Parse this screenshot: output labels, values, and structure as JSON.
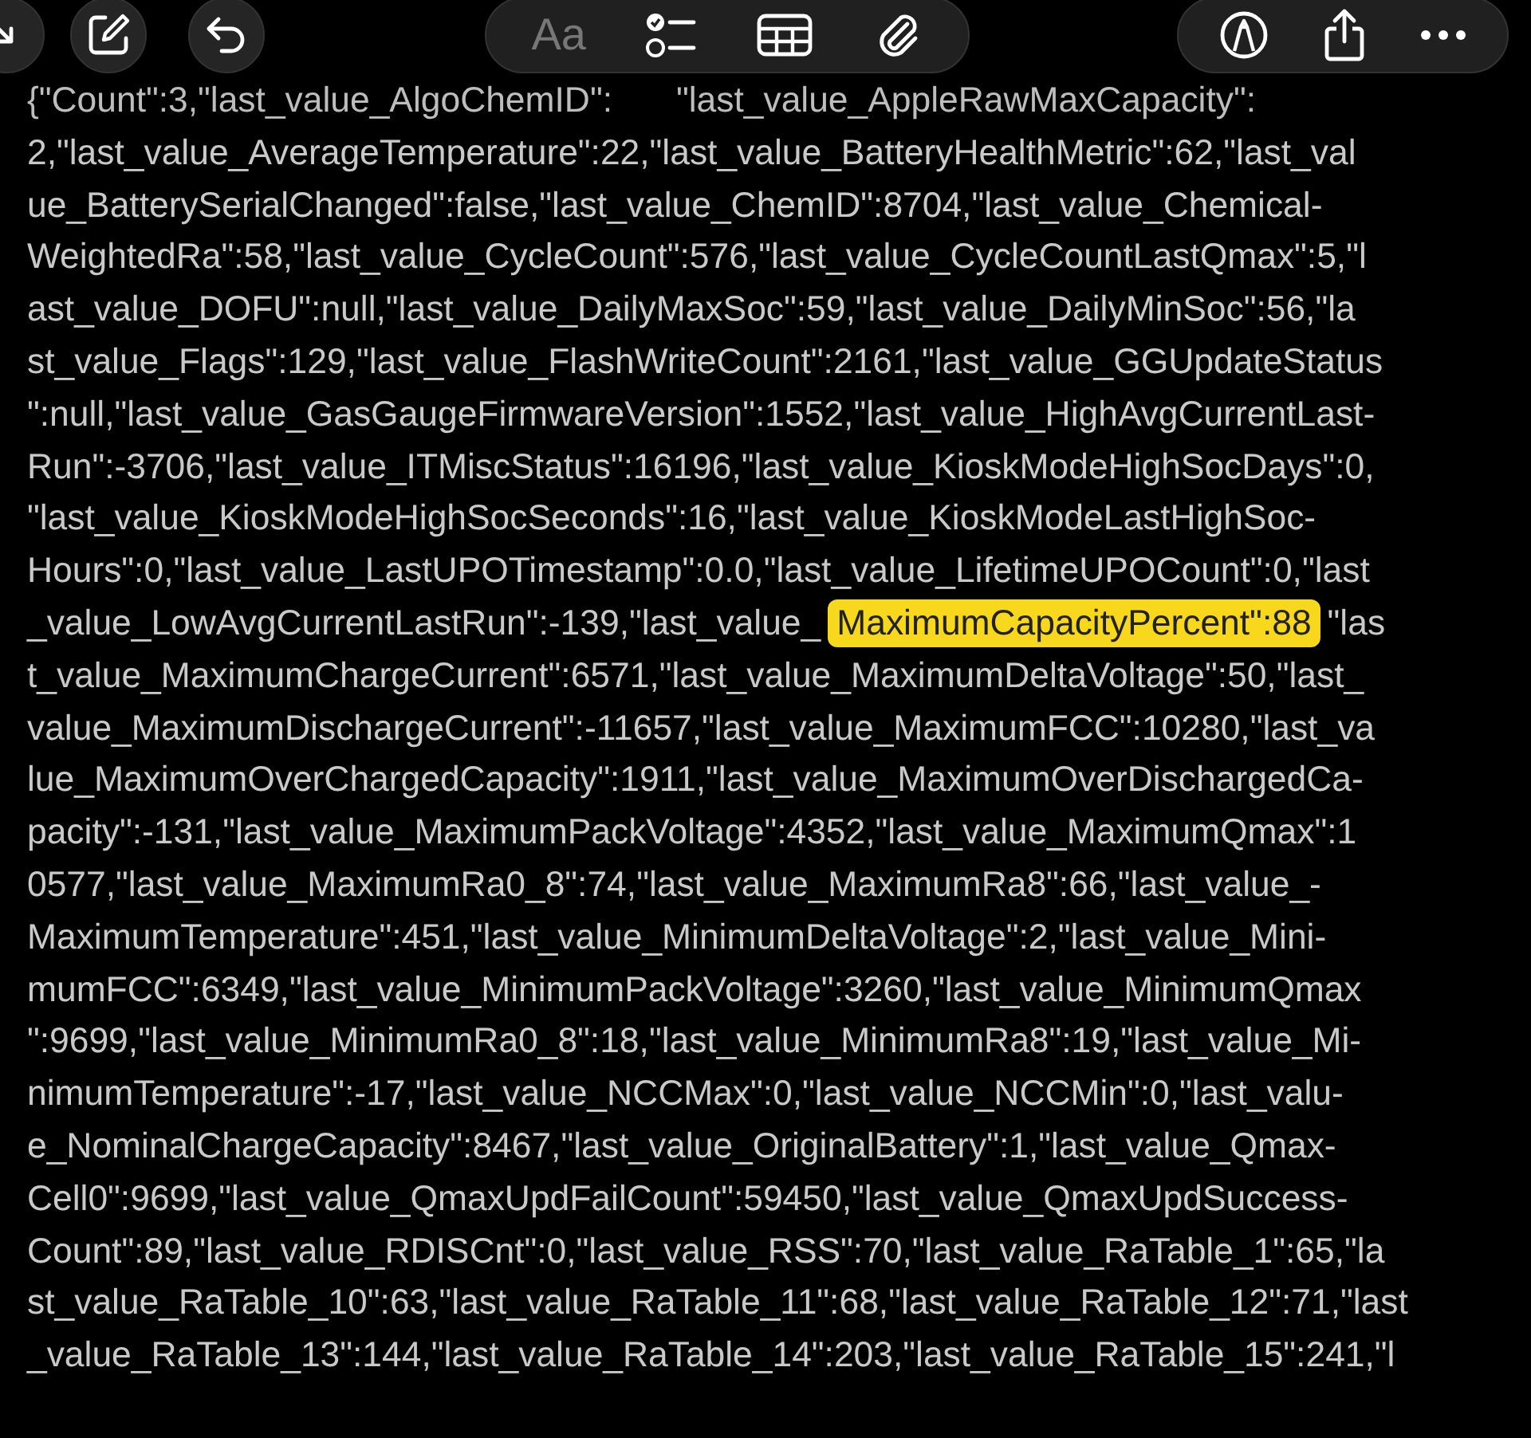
{
  "toolbar": {
    "format_label": "Aa"
  },
  "note": {
    "lines": [
      {
        "segments": [
          {
            "text": "{\"Count\":3,\"last_value_AlgoChemID\":",
            "highlighted": false
          },
          {
            "text": "\"last_value_AppleRawMaxCapacity\":",
            "highlighted": false
          }
        ]
      },
      {
        "segments": [
          {
            "text": "2,\"last_value_AverageTemperature\":22,\"last_value_BatteryHealthMetric\":62,\"last_val",
            "highlighted": false
          }
        ]
      },
      {
        "segments": [
          {
            "text": "ue_BatterySerialChanged\":false,\"last_value_ChemID\":8704,\"last_value_Chemical-",
            "highlighted": false
          }
        ]
      },
      {
        "segments": [
          {
            "text": "WeightedRa\":58,\"last_value_CycleCount\":576,\"last_value_CycleCountLastQmax\":5,\"l",
            "highlighted": false
          }
        ]
      },
      {
        "segments": [
          {
            "text": "ast_value_DOFU\":null,\"last_value_DailyMaxSoc\":59,\"last_value_DailyMinSoc\":56,\"la",
            "highlighted": false
          }
        ]
      },
      {
        "segments": [
          {
            "text": "st_value_Flags\":129,\"last_value_FlashWriteCount\":2161,\"last_value_GGUpdateStatus",
            "highlighted": false
          }
        ]
      },
      {
        "segments": [
          {
            "text": "\":null,\"last_value_GasGaugeFirmwareVersion\":1552,\"last_value_HighAvgCurrentLast-",
            "highlighted": false
          }
        ]
      },
      {
        "segments": [
          {
            "text": "Run\":-3706,\"last_value_ITMiscStatus\":16196,\"last_value_KioskModeHighSocDays\":0,",
            "highlighted": false
          }
        ]
      },
      {
        "segments": [
          {
            "text": "\"last_value_KioskModeHighSocSeconds\":16,\"last_value_KioskModeLastHighSoc-",
            "highlighted": false
          }
        ]
      },
      {
        "segments": [
          {
            "text": "Hours\":0,\"last_value_LastUPOTimestamp\":0.0,\"last_value_LifetimeUPOCount\":0,\"last",
            "highlighted": false
          }
        ]
      },
      {
        "segments": [
          {
            "text": "_value_LowAvgCurrentLastRun\":-139,\"last_value_",
            "highlighted": false
          },
          {
            "text": "MaximumCapacityPercent\":88",
            "highlighted": true
          },
          {
            "text": "\"las",
            "highlighted": false
          }
        ]
      },
      {
        "segments": [
          {
            "text": "t_value_MaximumChargeCurrent\":6571,\"last_value_MaximumDeltaVoltage\":50,\"last_",
            "highlighted": false
          }
        ]
      },
      {
        "segments": [
          {
            "text": "value_MaximumDischargeCurrent\":-11657,\"last_value_MaximumFCC\":10280,\"last_va",
            "highlighted": false
          }
        ]
      },
      {
        "segments": [
          {
            "text": "lue_MaximumOverChargedCapacity\":1911,\"last_value_MaximumOverDischargedCa-",
            "highlighted": false
          }
        ]
      },
      {
        "segments": [
          {
            "text": "pacity\":-131,\"last_value_MaximumPackVoltage\":4352,\"last_value_MaximumQmax\":1",
            "highlighted": false
          }
        ]
      },
      {
        "segments": [
          {
            "text": "0577,\"last_value_MaximumRa0_8\":74,\"last_value_MaximumRa8\":66,\"last_value_-",
            "highlighted": false
          }
        ]
      },
      {
        "segments": [
          {
            "text": "MaximumTemperature\":451,\"last_value_MinimumDeltaVoltage\":2,\"last_value_Mini-",
            "highlighted": false
          }
        ]
      },
      {
        "segments": [
          {
            "text": "mumFCC\":6349,\"last_value_MinimumPackVoltage\":3260,\"last_value_MinimumQmax",
            "highlighted": false
          }
        ]
      },
      {
        "segments": [
          {
            "text": "\":9699,\"last_value_MinimumRa0_8\":18,\"last_value_MinimumRa8\":19,\"last_value_Mi-",
            "highlighted": false
          }
        ]
      },
      {
        "segments": [
          {
            "text": "nimumTemperature\":-17,\"last_value_NCCMax\":0,\"last_value_NCCMin\":0,\"last_valu-",
            "highlighted": false
          }
        ]
      },
      {
        "segments": [
          {
            "text": "e_NominalChargeCapacity\":8467,\"last_value_OriginalBattery\":1,\"last_value_Qmax-",
            "highlighted": false
          }
        ]
      },
      {
        "segments": [
          {
            "text": "Cell0\":9699,\"last_value_QmaxUpdFailCount\":59450,\"last_value_QmaxUpdSuccess-",
            "highlighted": false
          }
        ]
      },
      {
        "segments": [
          {
            "text": "Count\":89,\"last_value_RDISCnt\":0,\"last_value_RSS\":70,\"last_value_RaTable_1\":65,\"la",
            "highlighted": false
          }
        ]
      },
      {
        "segments": [
          {
            "text": "st_value_RaTable_10\":63,\"last_value_RaTable_11\":68,\"last_value_RaTable_12\":71,\"last",
            "highlighted": false
          }
        ]
      },
      {
        "segments": [
          {
            "text": "_value_RaTable_13\":144,\"last_value_RaTable_14\":203,\"last_value_RaTable_15\":241,\"l",
            "highlighted": false
          }
        ]
      }
    ]
  }
}
